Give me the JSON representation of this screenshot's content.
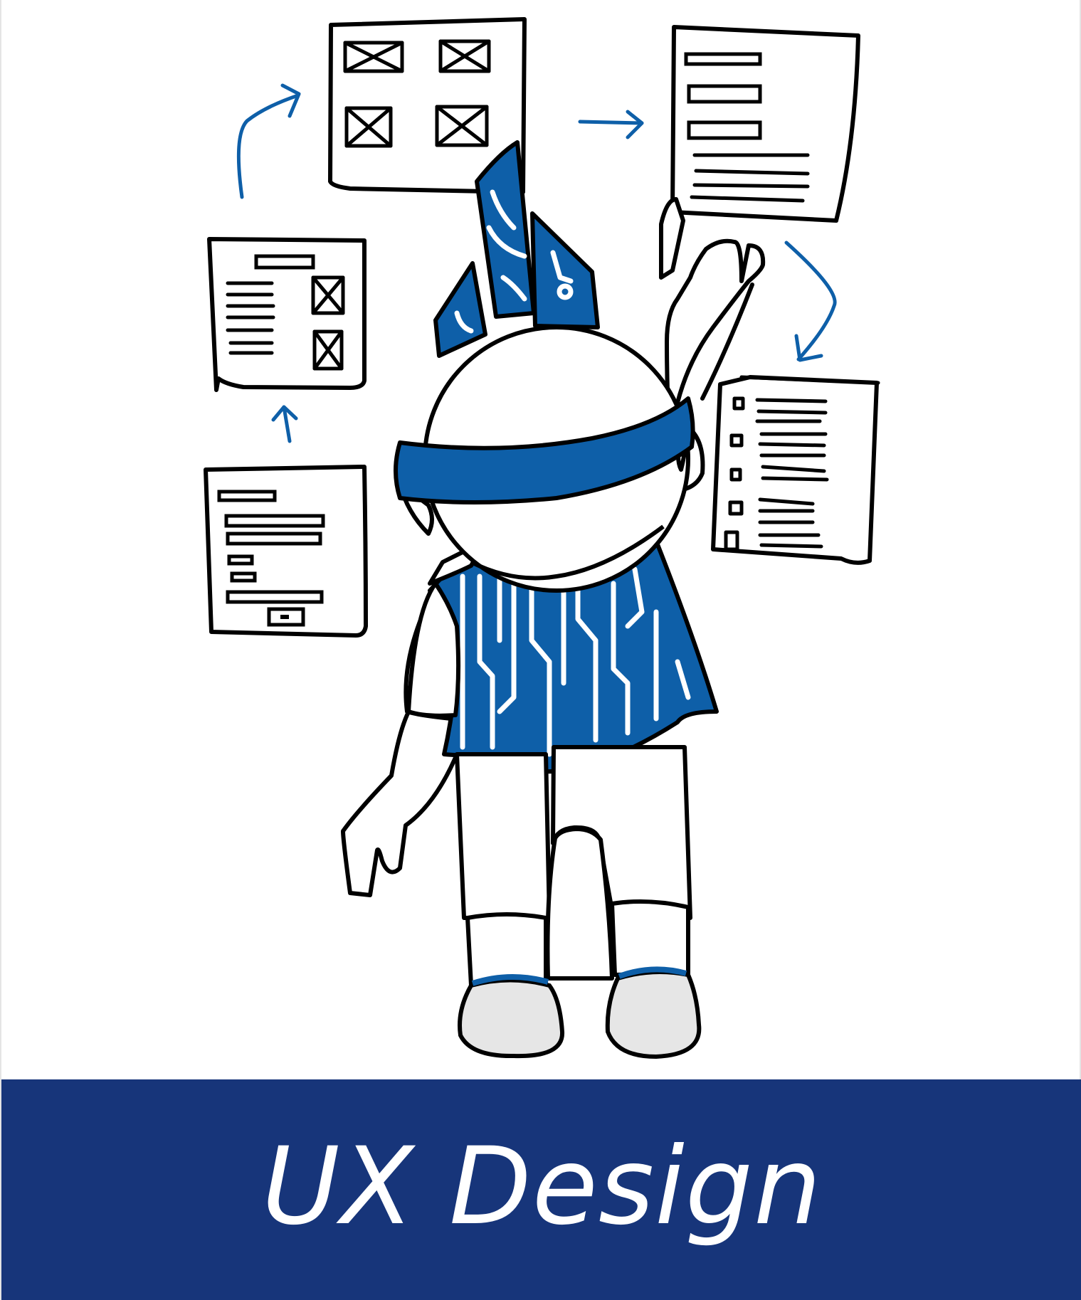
{
  "title": "UX Design",
  "colors": {
    "banner": "#17357a",
    "accent": "#0e5fa8",
    "ink": "#000000",
    "shoe": "#e6e6e6"
  },
  "illustration": {
    "subject": "person-at-wireframe-board",
    "icons": [
      "wireframe-sheet-icon",
      "flow-arrow-icon",
      "pencil-icon"
    ]
  }
}
